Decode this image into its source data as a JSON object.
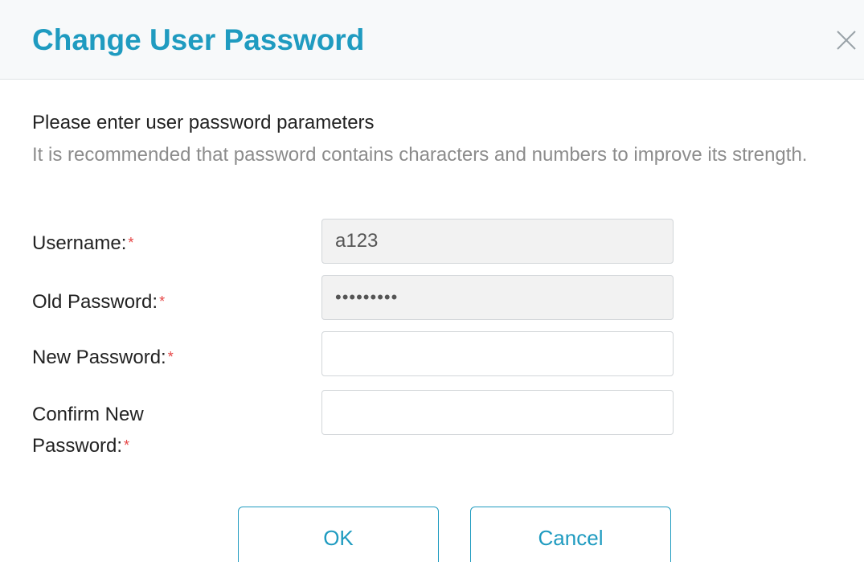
{
  "dialog": {
    "title": "Change User Password",
    "close_icon": "close-icon"
  },
  "intro": {
    "title": "Please enter user password parameters",
    "hint": "It is recommended that password contains characters and numbers to improve its strength."
  },
  "form": {
    "required_mark": "*",
    "username": {
      "label": "Username:",
      "value": "a123"
    },
    "old_password": {
      "label": "Old Password:",
      "value": "•••••••••"
    },
    "new_password": {
      "label": "New Password:",
      "value": ""
    },
    "confirm_password": {
      "label_line1": "Confirm New",
      "label_line2": "Password:",
      "value": ""
    }
  },
  "buttons": {
    "ok": "OK",
    "cancel": "Cancel"
  },
  "colors": {
    "accent": "#1f9bc0",
    "required": "#e64545",
    "header_bg": "#f7f9fa",
    "disabled_field_bg": "#f2f2f2"
  }
}
